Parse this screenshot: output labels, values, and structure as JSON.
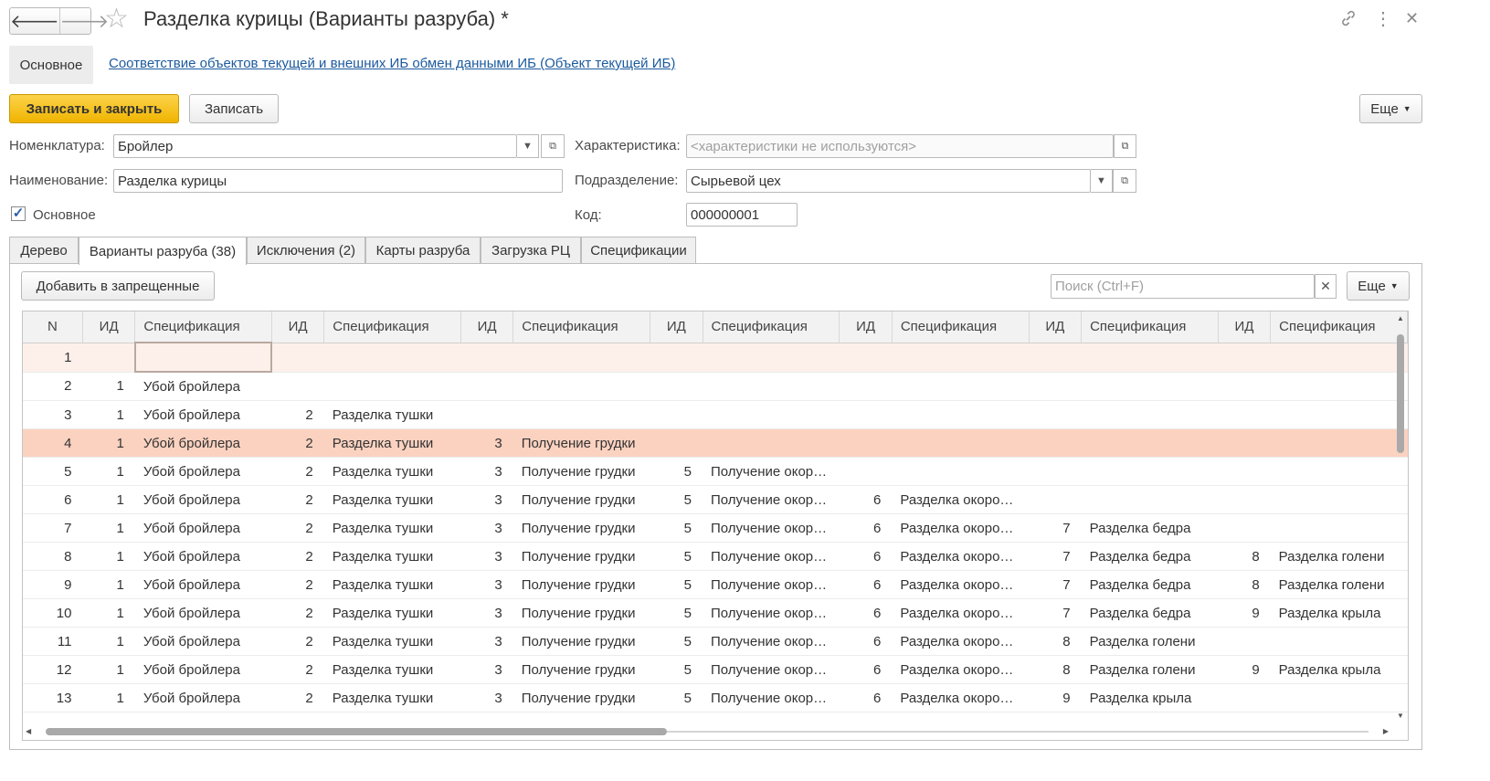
{
  "window": {
    "title": "Разделка курицы (Варианты разруба) *",
    "back_glyph": "🡐",
    "forward_glyph": "🡒"
  },
  "sections": {
    "active": "Основное",
    "link": "Соответствие объектов текущей и внешних ИБ обмен данными ИБ (Объект текущей ИБ)"
  },
  "toolbar": {
    "save_close": "Записать и закрыть",
    "save": "Записать",
    "more": "Еще"
  },
  "form": {
    "nomenclature_label": "Номенклатура:",
    "nomenclature_value": "Бройлер",
    "name_label": "Наименование:",
    "name_value": "Разделка курицы",
    "characteristic_label": "Характеристика:",
    "characteristic_placeholder": "<характеристики не используются>",
    "department_label": "Подразделение:",
    "department_value": "Сырьевой цех",
    "code_label": "Код:",
    "code_value": "000000001",
    "main_checkbox_label": "Основное",
    "main_checked": true
  },
  "tabs": [
    {
      "label": "Дерево"
    },
    {
      "label": "Варианты разруба (38)"
    },
    {
      "label": "Исключения (2)"
    },
    {
      "label": "Карты разруба"
    },
    {
      "label": "Загрузка РЦ"
    },
    {
      "label": "Спецификации"
    }
  ],
  "panel": {
    "add_forbidden": "Добавить в запрещенные",
    "search_placeholder": "Поиск (Ctrl+F)",
    "more": "Еще"
  },
  "table": {
    "columns": [
      "N",
      "ИД",
      "Спецификация",
      "ИД",
      "Спецификация",
      "ИД",
      "Спецификация",
      "ИД",
      "Спецификация",
      "ИД",
      "Спецификация",
      "ИД",
      "Спецификация",
      "ИД",
      "Спецификация"
    ],
    "rows": [
      [
        "1",
        "",
        "",
        "",
        "",
        "",
        "",
        "",
        "",
        "",
        "",
        "",
        "",
        "",
        ""
      ],
      [
        "2",
        "1",
        "Убой бройлера",
        "",
        "",
        "",
        "",
        "",
        "",
        "",
        "",
        "",
        "",
        "",
        ""
      ],
      [
        "3",
        "1",
        "Убой бройлера",
        "2",
        "Разделка тушки",
        "",
        "",
        "",
        "",
        "",
        "",
        "",
        "",
        "",
        ""
      ],
      [
        "4",
        "1",
        "Убой бройлера",
        "2",
        "Разделка тушки",
        "3",
        "Получение грудки",
        "",
        "",
        "",
        "",
        "",
        "",
        "",
        ""
      ],
      [
        "5",
        "1",
        "Убой бройлера",
        "2",
        "Разделка тушки",
        "3",
        "Получение грудки",
        "5",
        "Получение окор…",
        "",
        "",
        "",
        "",
        "",
        ""
      ],
      [
        "6",
        "1",
        "Убой бройлера",
        "2",
        "Разделка тушки",
        "3",
        "Получение грудки",
        "5",
        "Получение окор…",
        "6",
        "Разделка окоро…",
        "",
        "",
        "",
        ""
      ],
      [
        "7",
        "1",
        "Убой бройлера",
        "2",
        "Разделка тушки",
        "3",
        "Получение грудки",
        "5",
        "Получение окор…",
        "6",
        "Разделка окоро…",
        "7",
        "Разделка бедра",
        "",
        ""
      ],
      [
        "8",
        "1",
        "Убой бройлера",
        "2",
        "Разделка тушки",
        "3",
        "Получение грудки",
        "5",
        "Получение окор…",
        "6",
        "Разделка окоро…",
        "7",
        "Разделка бедра",
        "8",
        "Разделка голени"
      ],
      [
        "9",
        "1",
        "Убой бройлера",
        "2",
        "Разделка тушки",
        "3",
        "Получение грудки",
        "5",
        "Получение окор…",
        "6",
        "Разделка окоро…",
        "7",
        "Разделка бедра",
        "8",
        "Разделка голени"
      ],
      [
        "10",
        "1",
        "Убой бройлера",
        "2",
        "Разделка тушки",
        "3",
        "Получение грудки",
        "5",
        "Получение окор…",
        "6",
        "Разделка окоро…",
        "7",
        "Разделка бедра",
        "9",
        "Разделка крыла"
      ],
      [
        "11",
        "1",
        "Убой бройлера",
        "2",
        "Разделка тушки",
        "3",
        "Получение грудки",
        "5",
        "Получение окор…",
        "6",
        "Разделка окоро…",
        "8",
        "Разделка голени",
        "",
        ""
      ],
      [
        "12",
        "1",
        "Убой бройлера",
        "2",
        "Разделка тушки",
        "3",
        "Получение грудки",
        "5",
        "Получение окор…",
        "6",
        "Разделка окоро…",
        "8",
        "Разделка голени",
        "9",
        "Разделка крыла"
      ],
      [
        "13",
        "1",
        "Убой бройлера",
        "2",
        "Разделка тушки",
        "3",
        "Получение грудки",
        "5",
        "Получение окор…",
        "6",
        "Разделка окоро…",
        "9",
        "Разделка крыла",
        "",
        ""
      ]
    ],
    "selected_row": 4
  },
  "colors": {
    "primary_button": "#f5c518",
    "selected_row": "#fbd2c0",
    "link": "#1c5a9e"
  }
}
